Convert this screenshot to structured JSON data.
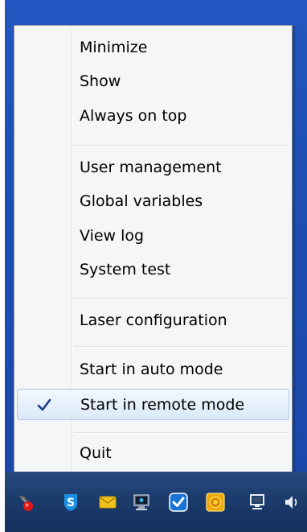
{
  "menu": {
    "items": [
      {
        "label": "Minimize"
      },
      {
        "label": "Show"
      },
      {
        "label": "Always on top"
      },
      {
        "label": "User management"
      },
      {
        "label": "Global variables"
      },
      {
        "label": "View log"
      },
      {
        "label": "System test"
      },
      {
        "label": "Laser configuration"
      },
      {
        "label": "Start in auto mode"
      },
      {
        "label": "Start in remote mode",
        "checked": true,
        "highlighted": true
      },
      {
        "label": "Quit"
      }
    ]
  },
  "tray": {
    "icons": [
      "app-tray-icon",
      "shield-s-icon",
      "mail-icon",
      "network-monitor-icon",
      "sync-icon",
      "coin-icon",
      "display-icon",
      "speaker-icon"
    ]
  },
  "colors": {
    "desktop": "#1d4fb0",
    "taskbar": "#1b3b6c",
    "menu_bg": "#f5f6f7",
    "highlight_border": "#a9c8ec",
    "check": "#1e3c8c"
  }
}
